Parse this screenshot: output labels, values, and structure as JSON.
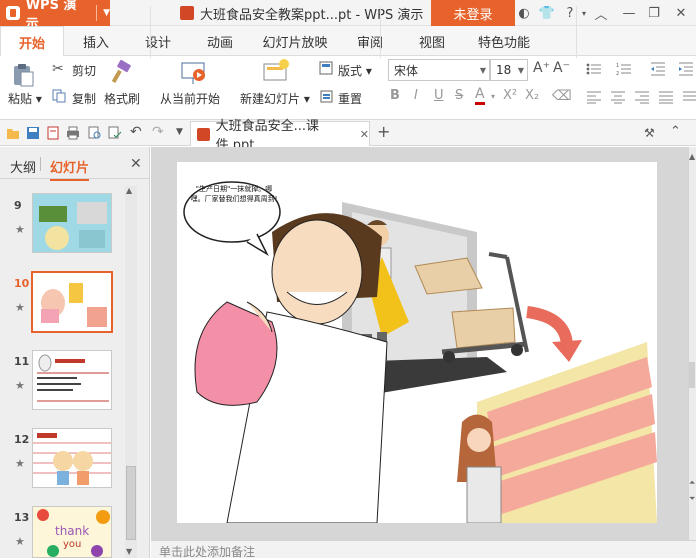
{
  "app": {
    "name": "WPS 演示",
    "login_label": "未登录"
  },
  "document": {
    "title": "大班食品安全教案ppt...pt - WPS 演示",
    "tab_label": "大班食品安全...课件.ppt"
  },
  "menu_tabs": [
    "开始",
    "插入",
    "设计",
    "动画",
    "幻灯片放映",
    "审阅",
    "视图",
    "特色功能"
  ],
  "ribbon": {
    "paste": "粘贴",
    "cut": "剪切",
    "copy": "复制",
    "format_painter": "格式刷",
    "from_current": "从当前开始",
    "new_slide": "新建幻灯片",
    "layout": "版式",
    "reset": "重置",
    "font_name": "宋体",
    "font_size": "18"
  },
  "left_panel": {
    "tab_outline": "大纲",
    "tab_slides": "幻灯片",
    "slides": [
      {
        "number": "9"
      },
      {
        "number": "10"
      },
      {
        "number": "11"
      },
      {
        "number": "12"
      },
      {
        "number": "13"
      }
    ],
    "selected_slide": "10"
  },
  "slide": {
    "speech_bubble": "\"生产日期\"一抹就掉。哪嘿。厂家替我们想得真周到!"
  },
  "notes_placeholder": "单击此处添加备注",
  "colors": {
    "accent": "#e7632b"
  }
}
